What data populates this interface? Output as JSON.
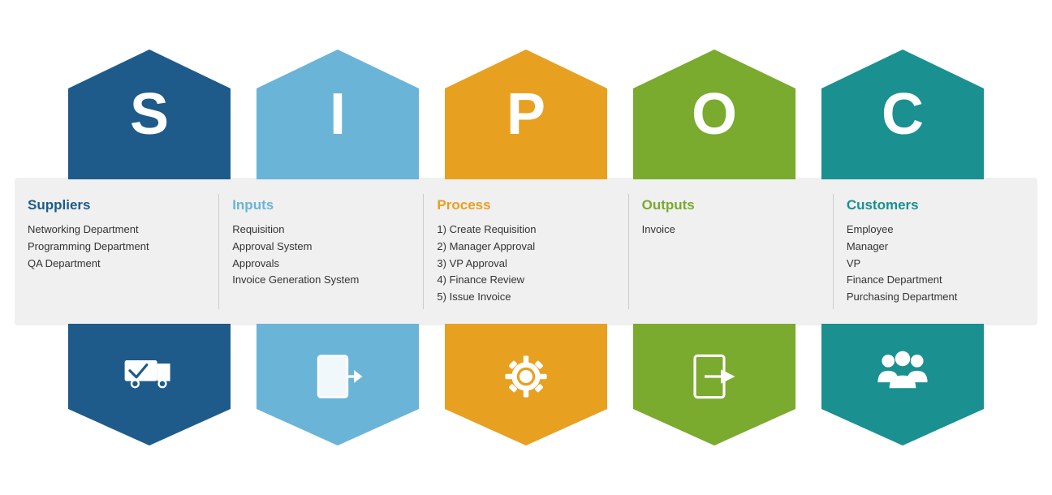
{
  "columns": [
    {
      "letter": "S",
      "colorClass": "s-color",
      "titleClass": "s-title",
      "title": "Suppliers",
      "items": [
        "Networking Department",
        "Programming Department",
        "QA Department"
      ],
      "numbered": false,
      "icon": "truck"
    },
    {
      "letter": "I",
      "colorClass": "i-color",
      "titleClass": "i-title",
      "title": "Inputs",
      "items": [
        "Requisition",
        "Approval System",
        "Approvals",
        "Invoice Generation System"
      ],
      "numbered": false,
      "icon": "input"
    },
    {
      "letter": "P",
      "colorClass": "p-color",
      "titleClass": "p-title",
      "title": "Process",
      "items": [
        "Create Requisition",
        "Manager Approval",
        "VP Approval",
        "Finance Review",
        "Issue Invoice"
      ],
      "numbered": true,
      "icon": "gear"
    },
    {
      "letter": "O",
      "colorClass": "o-color",
      "titleClass": "o-title",
      "title": "Outputs",
      "items": [
        "Invoice"
      ],
      "numbered": false,
      "icon": "output"
    },
    {
      "letter": "C",
      "colorClass": "c-color",
      "titleClass": "c-title",
      "title": "Customers",
      "items": [
        "Employee",
        "Manager",
        "VP",
        "Finance Department",
        "Purchasing Department"
      ],
      "numbered": false,
      "icon": "people"
    }
  ]
}
